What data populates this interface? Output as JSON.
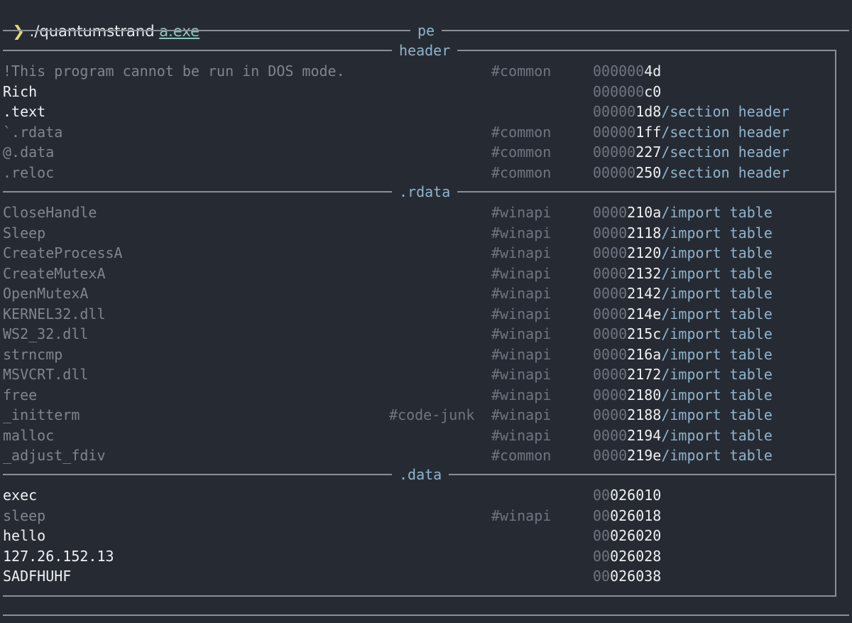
{
  "terminal": {
    "prompt_symbol": "❯",
    "command": "./quantumstrand",
    "argument": "a.exe"
  },
  "frames": {
    "outer_title": "pe",
    "sections": [
      {
        "title": "header",
        "rows": [
          {
            "text": "!This program cannot be run in DOS mode.",
            "tag1": "",
            "tag2": "#common",
            "offset_zeros": "000000",
            "offset_digits": "4d",
            "structure": "",
            "style": "dim"
          },
          {
            "text": "Rich",
            "tag1": "",
            "tag2": "",
            "offset_zeros": "000000",
            "offset_digits": "c0",
            "structure": "",
            "style": "bright"
          },
          {
            "text": ".text",
            "tag1": "",
            "tag2": "",
            "offset_zeros": "00000",
            "offset_digits": "1d8",
            "structure": "/section header",
            "style": "bright"
          },
          {
            "text": "`.rdata",
            "tag1": "",
            "tag2": "#common",
            "offset_zeros": "00000",
            "offset_digits": "1ff",
            "structure": "/section header",
            "style": "dim"
          },
          {
            "text": "@.data",
            "tag1": "",
            "tag2": "#common",
            "offset_zeros": "00000",
            "offset_digits": "227",
            "structure": "/section header",
            "style": "dim"
          },
          {
            "text": ".reloc",
            "tag1": "",
            "tag2": "#common",
            "offset_zeros": "00000",
            "offset_digits": "250",
            "structure": "/section header",
            "style": "dim"
          }
        ]
      },
      {
        "title": ".rdata",
        "rows": [
          {
            "text": "CloseHandle",
            "tag1": "",
            "tag2": "#winapi",
            "offset_zeros": "0000",
            "offset_digits": "210a",
            "structure": "/import table",
            "style": "dim"
          },
          {
            "text": "Sleep",
            "tag1": "",
            "tag2": "#winapi",
            "offset_zeros": "0000",
            "offset_digits": "2118",
            "structure": "/import table",
            "style": "dim"
          },
          {
            "text": "CreateProcessA",
            "tag1": "",
            "tag2": "#winapi",
            "offset_zeros": "0000",
            "offset_digits": "2120",
            "structure": "/import table",
            "style": "dim"
          },
          {
            "text": "CreateMutexA",
            "tag1": "",
            "tag2": "#winapi",
            "offset_zeros": "0000",
            "offset_digits": "2132",
            "structure": "/import table",
            "style": "dim"
          },
          {
            "text": "OpenMutexA",
            "tag1": "",
            "tag2": "#winapi",
            "offset_zeros": "0000",
            "offset_digits": "2142",
            "structure": "/import table",
            "style": "dim"
          },
          {
            "text": "KERNEL32.dll",
            "tag1": "",
            "tag2": "#winapi",
            "offset_zeros": "0000",
            "offset_digits": "214e",
            "structure": "/import table",
            "style": "dim"
          },
          {
            "text": "WS2_32.dll",
            "tag1": "",
            "tag2": "#winapi",
            "offset_zeros": "0000",
            "offset_digits": "215c",
            "structure": "/import table",
            "style": "dim"
          },
          {
            "text": "strncmp",
            "tag1": "",
            "tag2": "#winapi",
            "offset_zeros": "0000",
            "offset_digits": "216a",
            "structure": "/import table",
            "style": "dim"
          },
          {
            "text": "MSVCRT.dll",
            "tag1": "",
            "tag2": "#winapi",
            "offset_zeros": "0000",
            "offset_digits": "2172",
            "structure": "/import table",
            "style": "dim"
          },
          {
            "text": "free",
            "tag1": "",
            "tag2": "#winapi",
            "offset_zeros": "0000",
            "offset_digits": "2180",
            "structure": "/import table",
            "style": "dim"
          },
          {
            "text": "_initterm",
            "tag1": "#code-junk",
            "tag2": "#winapi",
            "offset_zeros": "0000",
            "offset_digits": "2188",
            "structure": "/import table",
            "style": "dim"
          },
          {
            "text": "malloc",
            "tag1": "",
            "tag2": "#winapi",
            "offset_zeros": "0000",
            "offset_digits": "2194",
            "structure": "/import table",
            "style": "dim"
          },
          {
            "text": "_adjust_fdiv",
            "tag1": "",
            "tag2": "#common",
            "offset_zeros": "0000",
            "offset_digits": "219e",
            "structure": "/import table",
            "style": "dim"
          }
        ]
      },
      {
        "title": ".data",
        "rows": [
          {
            "text": "exec",
            "tag1": "",
            "tag2": "",
            "offset_zeros": "00",
            "offset_digits": "026010",
            "structure": "",
            "style": "bright"
          },
          {
            "text": "sleep",
            "tag1": "",
            "tag2": "#winapi",
            "offset_zeros": "00",
            "offset_digits": "026018",
            "structure": "",
            "style": "dim"
          },
          {
            "text": "hello",
            "tag1": "",
            "tag2": "",
            "offset_zeros": "00",
            "offset_digits": "026020",
            "structure": "",
            "style": "bright"
          },
          {
            "text": "127.26.152.13",
            "tag1": "",
            "tag2": "",
            "offset_zeros": "00",
            "offset_digits": "026028",
            "structure": "",
            "style": "bright"
          },
          {
            "text": "SADFHUHF",
            "tag1": "",
            "tag2": "",
            "offset_zeros": "00",
            "offset_digits": "026038",
            "structure": "",
            "style": "bright"
          }
        ]
      }
    ]
  },
  "colors": {
    "background": "#262b33",
    "dim_text": "#7f858e",
    "bright_text": "#eef0f3",
    "accent_blue": "#8fb3cc",
    "border": "#8a8f96",
    "prompt_chevron": "#e6d37a",
    "argument": "#8cc7bf"
  }
}
